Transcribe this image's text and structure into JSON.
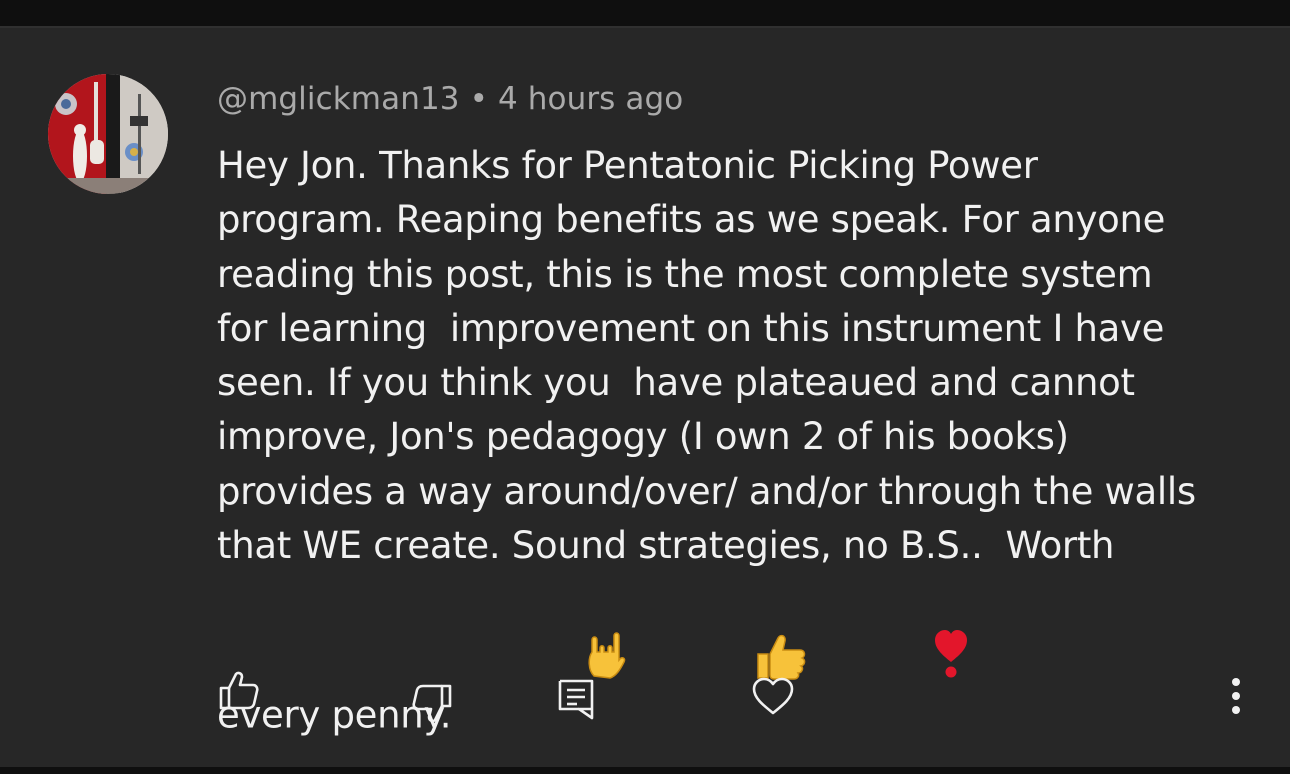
{
  "comment": {
    "author": "@mglickman13",
    "separator": "•",
    "time": "4 hours ago",
    "lines": [
      "Hey Jon. Thanks for Pentatonic Picking Power",
      "program. Reaping benefits as we speak. For anyone",
      "reading this post, this is the most complete system",
      "for learning  improvement on this instrument I have",
      "seen. If you think you  have plateaued and cannot",
      "improve, Jon's pedagogy (I own 2 of his books)",
      "provides a way around/over/ and/or through the walls",
      "that WE create. Sound strategies, no B.S..  Worth",
      "every penny."
    ],
    "emojis": [
      "sign-of-horns-emoji",
      "thumbs-up-emoji",
      "heart-exclamation-emoji"
    ]
  },
  "actions": {
    "like": "thumbs-up-icon",
    "dislike": "thumbs-down-icon",
    "reply": "reply-icon",
    "heart": "heart-icon",
    "more": "more-vert-icon"
  },
  "colors": {
    "background": "#272727",
    "text": "#f1f1f1",
    "meta": "#aaaaaa"
  }
}
